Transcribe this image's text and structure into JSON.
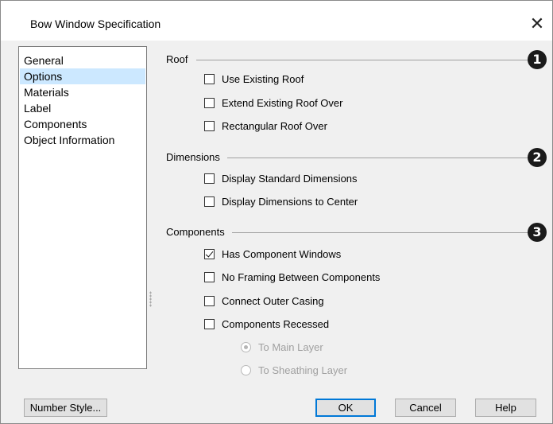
{
  "window": {
    "title": "Bow Window Specification",
    "close_symbol": "✕"
  },
  "nav": {
    "items": [
      {
        "label": "General",
        "selected": false
      },
      {
        "label": "Options",
        "selected": true
      },
      {
        "label": "Materials",
        "selected": false
      },
      {
        "label": "Label",
        "selected": false
      },
      {
        "label": "Components",
        "selected": false
      },
      {
        "label": "Object Information",
        "selected": false
      }
    ]
  },
  "sections": {
    "roof": {
      "label": "Roof",
      "callout": "1",
      "options": [
        {
          "label": "Use Existing Roof",
          "checked": false
        },
        {
          "label": "Extend Existing Roof Over",
          "checked": false
        },
        {
          "label": "Rectangular Roof Over",
          "checked": false
        }
      ]
    },
    "dimensions": {
      "label": "Dimensions",
      "callout": "2",
      "options": [
        {
          "label": "Display Standard Dimensions",
          "checked": false
        },
        {
          "label": "Display Dimensions to Center",
          "checked": false
        }
      ]
    },
    "components": {
      "label": "Components",
      "callout": "3",
      "options": [
        {
          "label": "Has Component Windows",
          "checked": true
        },
        {
          "label": "No Framing Between Components",
          "checked": false
        },
        {
          "label": "Connect Outer Casing",
          "checked": false
        },
        {
          "label": "Components Recessed",
          "checked": false
        }
      ],
      "radios": [
        {
          "label": "To Main Layer",
          "selected": true,
          "disabled": true
        },
        {
          "label": "To Sheathing Layer",
          "selected": false,
          "disabled": true
        }
      ]
    }
  },
  "buttons": {
    "number_style": "Number Style...",
    "ok": "OK",
    "cancel": "Cancel",
    "help": "Help"
  },
  "colors": {
    "selection": "#cce8ff",
    "default_button_border": "#0078d7",
    "callout": "#1a1a1a"
  }
}
